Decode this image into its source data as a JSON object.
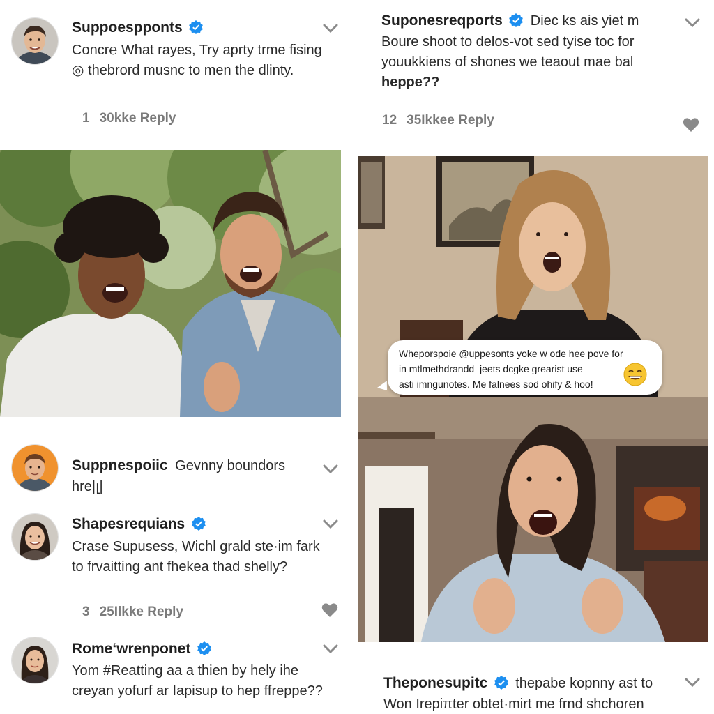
{
  "comments": [
    {
      "username": "Suppoesppont‌s",
      "verified": true,
      "text": "Concr℮ What rayes, Try aprty trme fising ◎ thebrord musnc to men the dlinty.",
      "likes": "1",
      "likes_label": "30kke Reply"
    },
    {
      "username": "Suponesreqports",
      "verified": true,
      "inline_text": "Diec ks ais yiet m",
      "text": "Boure shoot to delos-vot sed tyise toc for youukkiens of shones we teaout mae bal",
      "text_bold": "heppe??",
      "likes": "12",
      "likes_label": "35Ikkee Reply"
    },
    {
      "username": "Suppnespoiic",
      "verified": false,
      "inline_text": "Gevnny boundors",
      "text": "hre|լ|",
      "likes": "",
      "likes_label": ""
    },
    {
      "username": "Shapesrequians",
      "verified": true,
      "text": "Crase Supusess, Wichl grald ste·im fark to frvaitting ant fhekea thad shelly?",
      "likes": "3",
      "likes_label": "25Ilkke Reply"
    },
    {
      "username": "Rome‘wrenponet",
      "verified": true,
      "text": "Yom #Reatting aa a thien by hely ihe creyan yofurf ar Iapisup to hep ffreppe??",
      "likes": "",
      "likes_label": ""
    },
    {
      "username": "Theponesupitc",
      "verified": true,
      "inline_text": "thepabe kopnny ast to",
      "text": "Won Irepiπter obtet·mirt me frnd shchoren",
      "likes": "",
      "likes_label": ""
    }
  ],
  "speech_bubble": {
    "lines": [
      "Wheporspoie @uppesonts yoke w ode hee pove for",
      "in mtlmethdrandd_jeets dcgke grearist use",
      "asti imngunotes. Me falnees sod ohify & hoo!"
    ],
    "emoji": "grinning-face-emoji"
  },
  "colors": {
    "verified_blue": "#1d8ff0",
    "meta_gray": "#7a7a7a",
    "icon_gray": "#8a8a8a"
  }
}
